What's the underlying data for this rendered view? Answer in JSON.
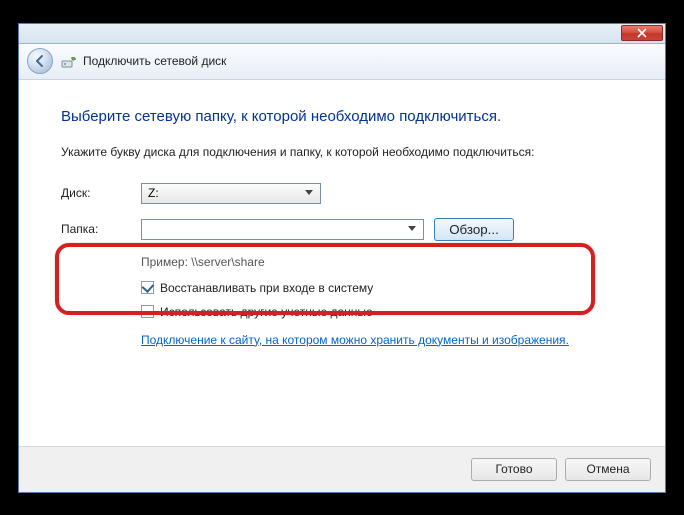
{
  "titlebar": {},
  "navbar": {
    "title": "Подключить сетевой диск"
  },
  "content": {
    "heading": "Выберите сетевую папку, к которой необходимо подключиться.",
    "instruction": "Укажите букву диска для подключения и папку, к которой необходимо подключиться:",
    "drive_label": "Диск:",
    "drive_value": "Z:",
    "folder_label": "Папка:",
    "folder_value": "",
    "browse_label": "Обзор...",
    "example": "Пример: \\\\server\\share",
    "reconnect_label": "Восстанавливать при входе в систему",
    "reconnect_checked": true,
    "othercreds_label": "Использовать другие учетные данные",
    "othercreds_checked": false,
    "link_text": "Подключение к сайту, на котором можно хранить документы и изображения"
  },
  "footer": {
    "finish": "Готово",
    "cancel": "Отмена"
  }
}
